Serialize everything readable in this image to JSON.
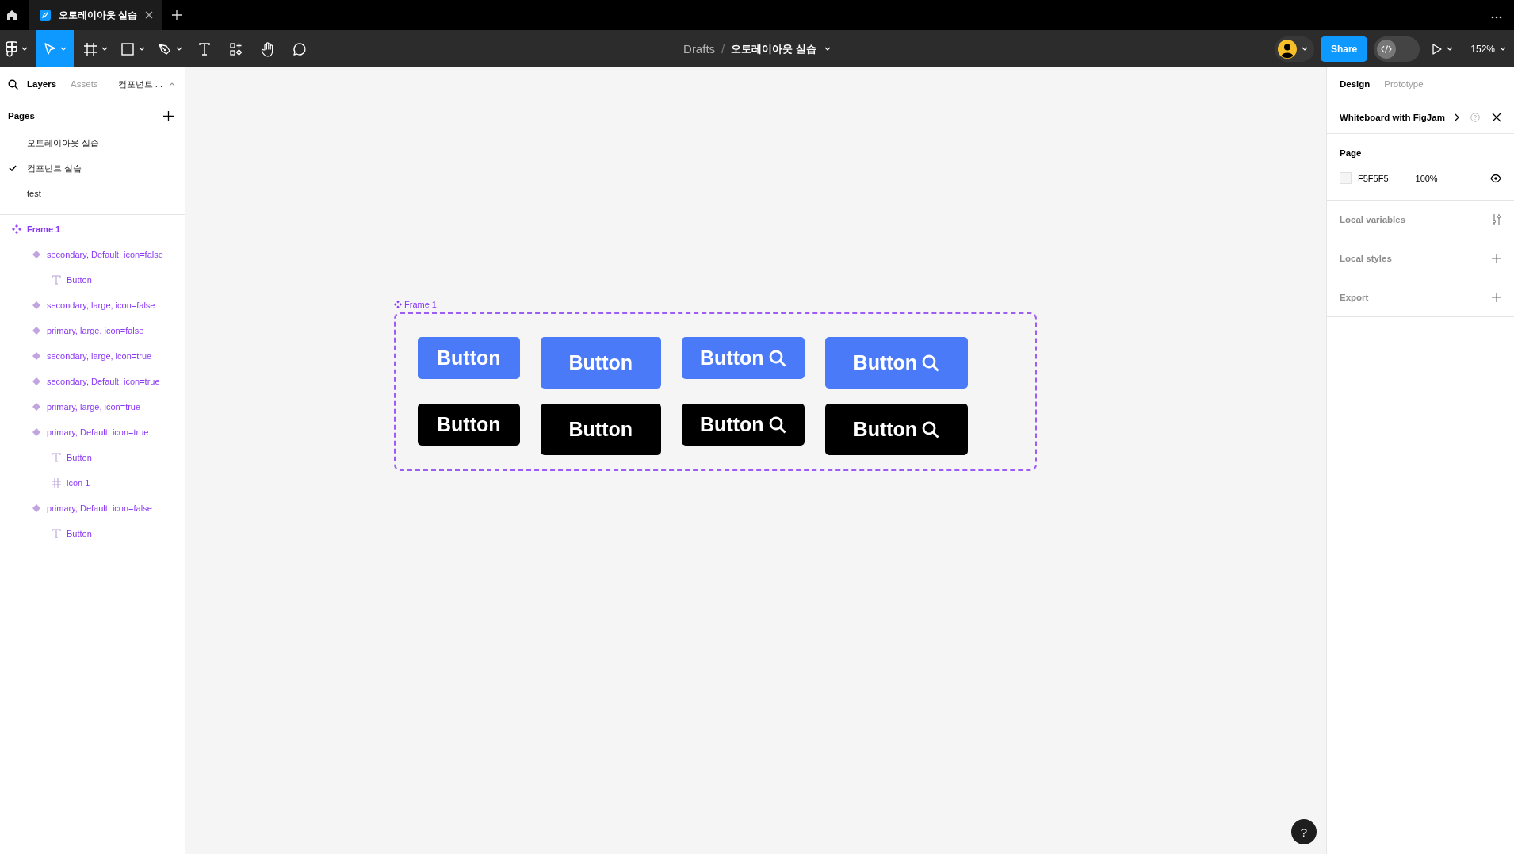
{
  "browser": {
    "tabs": [
      {
        "title": "오토레이아웃 실습",
        "selected": true
      }
    ]
  },
  "toolbar": {
    "tools": [
      {
        "kind": "main-menu",
        "selected": false,
        "dropdown": true
      },
      {
        "kind": "move",
        "selected": true,
        "dropdown": true
      },
      {
        "kind": "frame",
        "selected": false,
        "dropdown": true
      },
      {
        "kind": "shape",
        "selected": false,
        "dropdown": true
      },
      {
        "kind": "pen",
        "selected": false,
        "dropdown": true
      },
      {
        "kind": "text",
        "selected": false,
        "dropdown": false
      },
      {
        "kind": "resources",
        "selected": false,
        "dropdown": false
      },
      {
        "kind": "hand",
        "selected": false,
        "dropdown": false
      },
      {
        "kind": "comment",
        "selected": false,
        "dropdown": false
      }
    ],
    "breadcrumb": {
      "folder": "Drafts",
      "separator": "/",
      "file": "오토레이아웃 실습"
    },
    "share": "Share",
    "dev_mode": {
      "on": false
    },
    "zoom": "152%"
  },
  "left_panel": {
    "tabs": [
      {
        "label": "Layers",
        "selected": true
      },
      {
        "label": "Assets",
        "selected": false
      }
    ],
    "page_menu": "컴포넌트 ...",
    "pages_title": "Pages",
    "pages": [
      {
        "name": "오토레이아웃 실습",
        "selected": false
      },
      {
        "name": "컴포넌트 실습",
        "selected": true
      },
      {
        "name": "test",
        "selected": false
      }
    ],
    "layers": [
      {
        "kind": "component-set",
        "name": "Frame 1",
        "children": [
          {
            "kind": "component",
            "name": "secondary, Default, icon=false",
            "children": [
              {
                "kind": "text",
                "name": "Button"
              }
            ]
          },
          {
            "kind": "component",
            "name": "secondary, large, icon=false"
          },
          {
            "kind": "component",
            "name": "primary, large, icon=false"
          },
          {
            "kind": "component",
            "name": "secondary, large, icon=true"
          },
          {
            "kind": "component",
            "name": "secondary, Default, icon=true"
          },
          {
            "kind": "component",
            "name": "primary, large, icon=true"
          },
          {
            "kind": "component",
            "name": "primary, Default, icon=true",
            "children": [
              {
                "kind": "text",
                "name": "Button"
              },
              {
                "kind": "frame",
                "name": "icon 1"
              }
            ]
          },
          {
            "kind": "component",
            "name": "primary, Default, icon=false",
            "children": [
              {
                "kind": "text",
                "name": "Button"
              }
            ]
          }
        ]
      }
    ]
  },
  "canvas": {
    "frame_label": "Frame 1",
    "buttons": [
      {
        "label": "Button",
        "color": "#4a7af8",
        "large": false,
        "icon": false
      },
      {
        "label": "Button",
        "color": "#4a7af8",
        "large": true,
        "icon": false
      },
      {
        "label": "Button",
        "color": "#4a7af8",
        "large": false,
        "icon": true
      },
      {
        "label": "Button",
        "color": "#4a7af8",
        "large": true,
        "icon": true
      },
      {
        "label": "Button",
        "color": "#000000",
        "large": false,
        "icon": false
      },
      {
        "label": "Button",
        "color": "#000000",
        "large": true,
        "icon": false
      },
      {
        "label": "Button",
        "color": "#000000",
        "large": false,
        "icon": true
      },
      {
        "label": "Button",
        "color": "#000000",
        "large": true,
        "icon": true
      }
    ]
  },
  "right_panel": {
    "tabs": [
      {
        "label": "Design",
        "selected": true
      },
      {
        "label": "Prototype",
        "selected": false
      }
    ],
    "banner": "Whiteboard with FigJam",
    "page": {
      "title": "Page",
      "color": "F5F5F5",
      "opacity": "100%",
      "visible": true
    },
    "sections": [
      {
        "title": "Local variables",
        "kind": "variables"
      },
      {
        "title": "Local styles",
        "kind": "add"
      },
      {
        "title": "Export",
        "kind": "add"
      }
    ],
    "help": "?"
  }
}
